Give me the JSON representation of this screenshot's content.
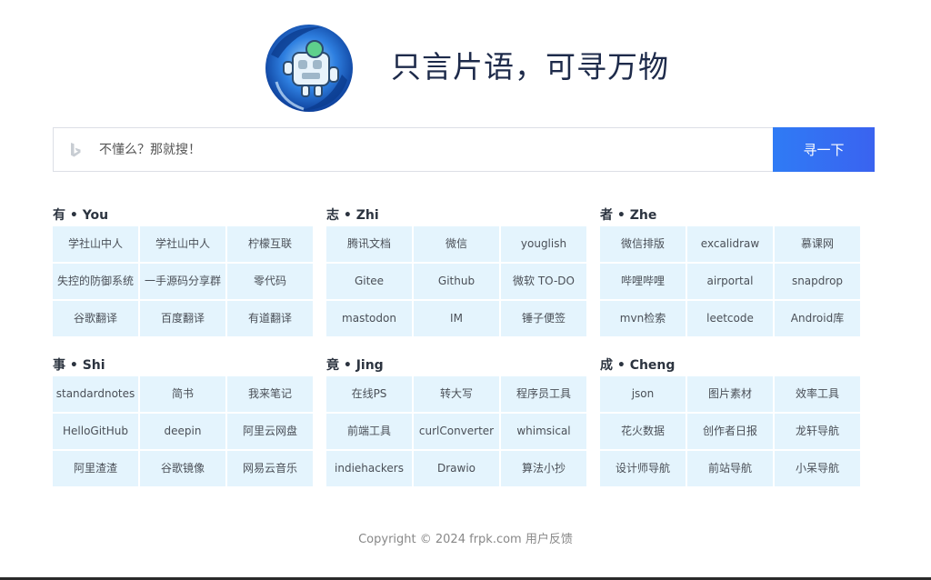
{
  "header": {
    "logo_icon": "robot-logo-icon",
    "slogan": "只言片语，可寻万物"
  },
  "search": {
    "engine_icon": "bing-icon",
    "placeholder": "不懂么？那就搜！",
    "value": "",
    "button_label": "寻一下",
    "accent": "#2f7bf5"
  },
  "groups": [
    {
      "title": "有 • You",
      "links": [
        "学社山中人",
        "学社山中人",
        "柠檬互联",
        "失控的防御系统",
        "一手源码分享群",
        "零代码",
        "谷歌翻译",
        "百度翻译",
        "有道翻译"
      ]
    },
    {
      "title": "志 • Zhi",
      "links": [
        "腾讯文档",
        "微信",
        "youglish",
        "Gitee",
        "Github",
        "微软 TO-DO",
        "mastodon",
        "IM",
        "锤子便签"
      ]
    },
    {
      "title": "者 • Zhe",
      "links": [
        "微信排版",
        "excalidraw",
        "慕课网",
        "哔哩哔哩",
        "airportal",
        "snapdrop",
        "mvn检索",
        "leetcode",
        "Android库"
      ]
    },
    {
      "title": "事 • Shi",
      "links": [
        "standardnotes",
        "简书",
        "我来笔记",
        "HelloGitHub",
        "deepin",
        "阿里云网盘",
        "阿里渣渣",
        "谷歌镜像",
        "网易云音乐"
      ]
    },
    {
      "title": "竟 • Jing",
      "links": [
        "在线PS",
        "转大写",
        "程序员工具",
        "前端工具",
        "curlConverter",
        "whimsical",
        "indiehackers",
        "Drawio",
        "算法小抄"
      ]
    },
    {
      "title": "成 • Cheng",
      "links": [
        "json",
        "图片素材",
        "效率工具",
        "花火数据",
        "创作者日报",
        "龙轩导航",
        "设计师导航",
        "前站导航",
        "小呆导航"
      ]
    }
  ],
  "footer": {
    "copyright": "Copyright © 2024 frpk.com",
    "feedback_label": "用户反馈"
  },
  "colors": {
    "link_bg": "#e4f4fd",
    "title": "#1d2a4a"
  }
}
